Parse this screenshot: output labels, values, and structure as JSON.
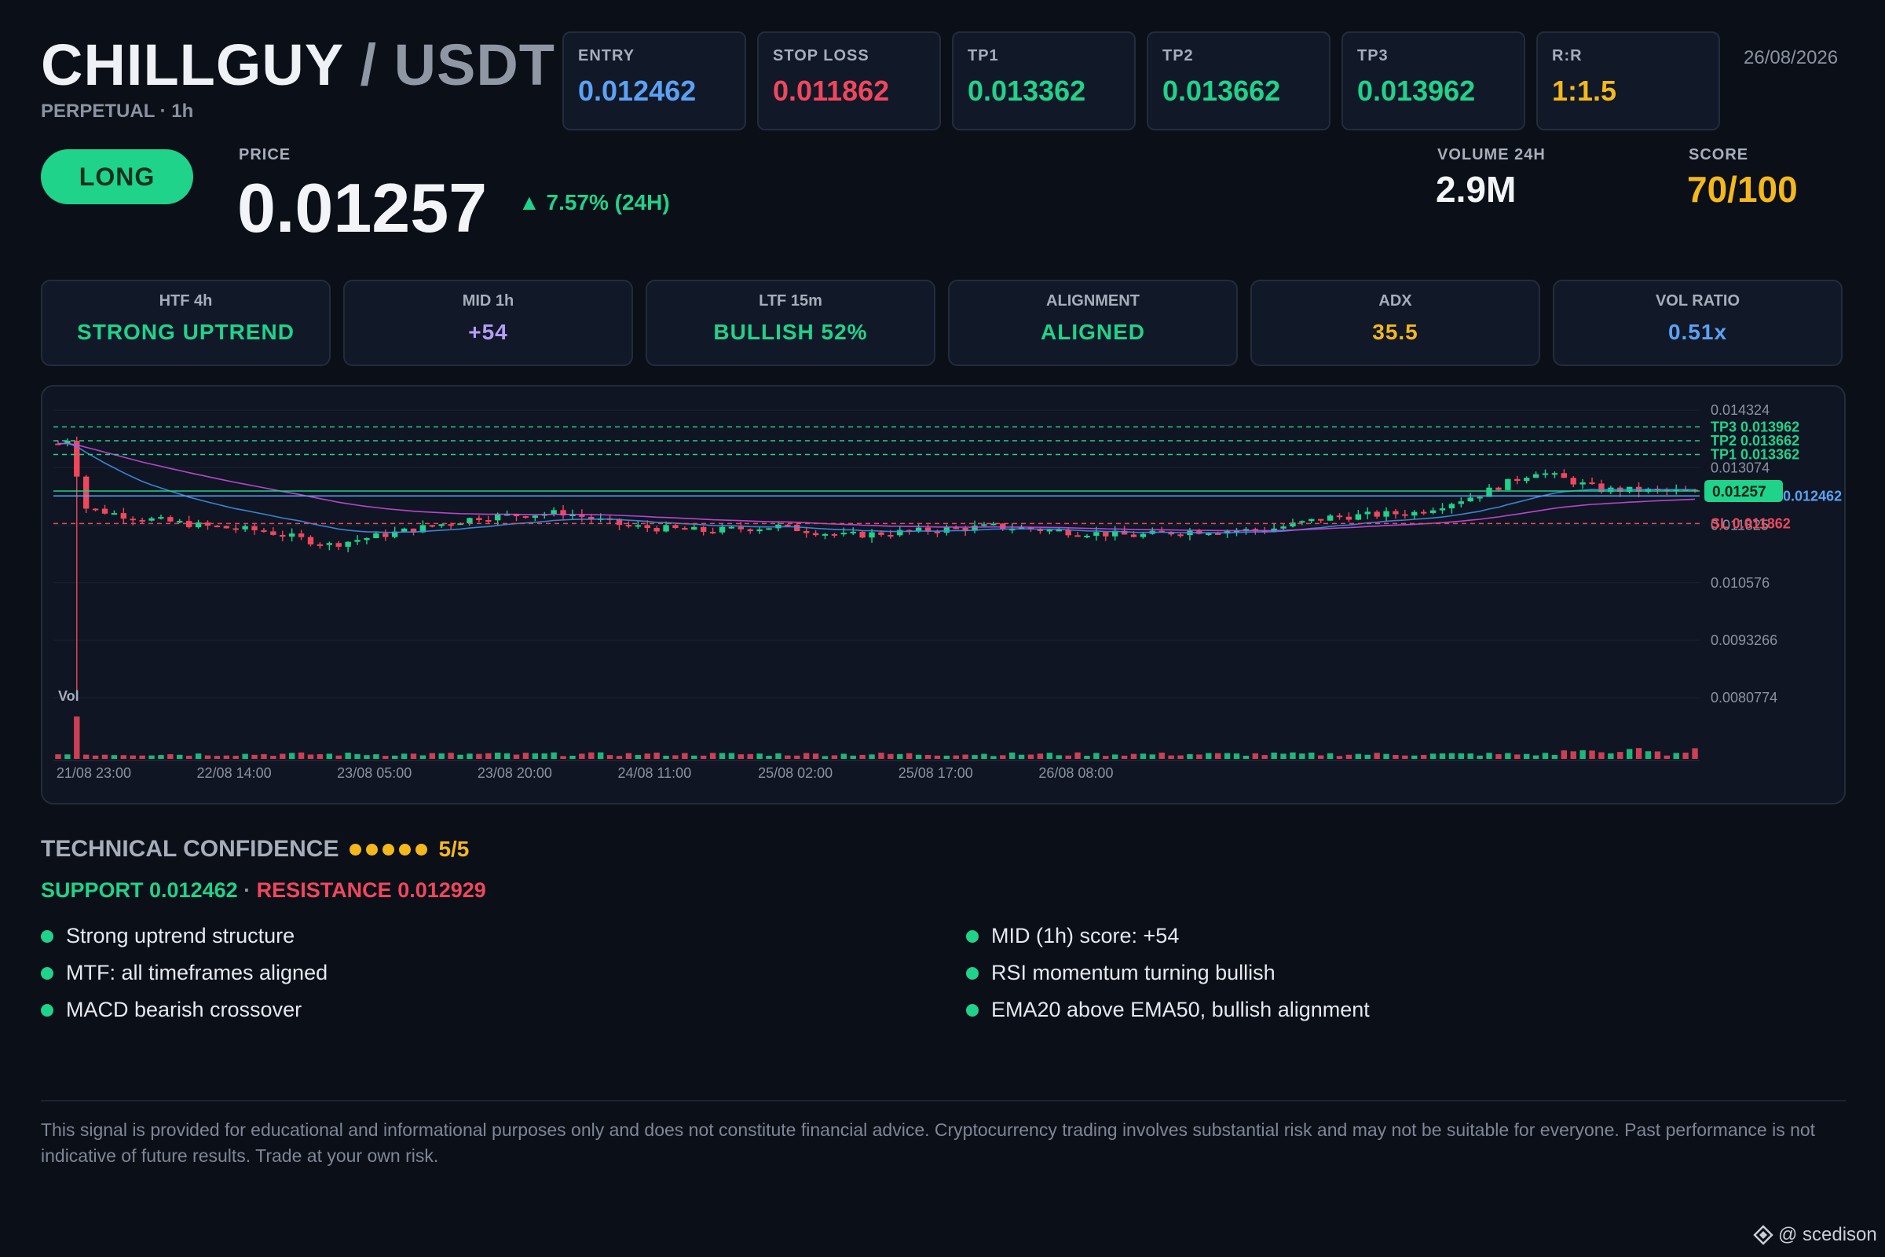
{
  "header": {
    "base": "CHILLGUY",
    "separator": "/",
    "quote": "USDT",
    "subtitle": "PERPETUAL · 1h",
    "date": "26/08/2026"
  },
  "levels": [
    {
      "label": "ENTRY",
      "value": "0.012462",
      "color": "#5aa2f5"
    },
    {
      "label": "STOP LOSS",
      "value": "0.011862",
      "color": "#f0475d"
    },
    {
      "label": "TP1",
      "value": "0.013362",
      "color": "#1fd38a"
    },
    {
      "label": "TP2",
      "value": "0.013662",
      "color": "#1fd38a"
    },
    {
      "label": "TP3",
      "value": "0.013962",
      "color": "#1fd38a"
    },
    {
      "label": "R:R",
      "value": "1:1.5",
      "color": "#f4b81c"
    }
  ],
  "signal": {
    "direction": "LONG",
    "price_label": "PRICE",
    "price": "0.01257",
    "change": "▲ 7.57% (24H)"
  },
  "stats": {
    "volume_label": "VOLUME 24H",
    "volume": "2.9M",
    "score_label": "SCORE",
    "score": "70/100"
  },
  "indicators": [
    {
      "label": "HTF 4h",
      "value": "STRONG UPTREND",
      "color": "#1fd38a"
    },
    {
      "label": "MID 1h",
      "value": "+54",
      "color": "#b79cf7"
    },
    {
      "label": "LTF 15m",
      "value": "BULLISH 52%",
      "color": "#1fd38a"
    },
    {
      "label": "ALIGNMENT",
      "value": "ALIGNED",
      "color": "#1fd38a"
    },
    {
      "label": "ADX",
      "value": "35.5",
      "color": "#f4b81c"
    },
    {
      "label": "VOL RATIO",
      "value": "0.51x",
      "color": "#5aa2f5"
    }
  ],
  "chart_data": {
    "type": "candlestick",
    "interval": "1h",
    "y_ticks": [
      "0.014324",
      "0.013074",
      "0.011825",
      "0.010576",
      "0.0093266",
      "0.0080774"
    ],
    "ylim": [
      0.0075,
      0.0146
    ],
    "x_ticks": [
      "21/08 23:00",
      "22/08 14:00",
      "23/08 05:00",
      "23/08 20:00",
      "24/08 11:00",
      "25/08 02:00",
      "25/08 17:00",
      "26/08 08:00"
    ],
    "volume_label": "Vol",
    "last_price_label": "0.01257",
    "last_price": 0.01257,
    "levels": [
      {
        "label": "TP3 0.013962",
        "value": 0.013962,
        "color": "#1fd38a"
      },
      {
        "label": "TP2 0.013662",
        "value": 0.013662,
        "color": "#1fd38a"
      },
      {
        "label": "TP1 0.013362",
        "value": 0.013362,
        "color": "#1fd38a"
      },
      {
        "label": "0.012462",
        "value": 0.012462,
        "color": "#5aa2f5"
      },
      {
        "label": "SL 0.011862",
        "value": 0.011862,
        "color": "#f0475d"
      }
    ],
    "anchors": [
      [
        0,
        0.0136
      ],
      [
        1,
        0.0137
      ],
      [
        3,
        0.0122
      ],
      [
        8,
        0.012
      ],
      [
        16,
        0.0118
      ],
      [
        22,
        0.0117
      ],
      [
        29,
        0.0114
      ],
      [
        37,
        0.0117
      ],
      [
        45,
        0.012
      ],
      [
        54,
        0.0121
      ],
      [
        61,
        0.0118
      ],
      [
        69,
        0.0117
      ],
      [
        77,
        0.0118
      ],
      [
        84,
        0.0116
      ],
      [
        92,
        0.0117
      ],
      [
        100,
        0.0118
      ],
      [
        107,
        0.0117
      ],
      [
        115,
        0.0116
      ],
      [
        121,
        0.0117
      ],
      [
        129,
        0.01172
      ],
      [
        136,
        0.012
      ],
      [
        145,
        0.0121
      ],
      [
        152,
        0.0125
      ],
      [
        158,
        0.013
      ],
      [
        165,
        0.0126
      ],
      [
        172,
        0.01257
      ]
    ],
    "volume_spike": {
      "index": 2,
      "relative": 9
    }
  },
  "confidence": {
    "label": "TECHNICAL CONFIDENCE",
    "score": "5/5",
    "dots": 5
  },
  "support_resistance": {
    "support": "SUPPORT 0.012462",
    "separator": "·",
    "resistance": "RESISTANCE 0.012929"
  },
  "reasons": [
    "Strong uptrend structure",
    "MID (1h) score: +54",
    "MTF: all timeframes aligned",
    "RSI momentum turning bullish",
    "MACD bearish crossover",
    "EMA20 above EMA50, bullish alignment"
  ],
  "disclaimer": "This signal is provided for educational and informational purposes only and does not constitute financial advice. Cryptocurrency trading involves substantial risk and may not be suitable for everyone. Past performance is not indicative of future results. Trade at your own risk.",
  "watermark": "@ scedison"
}
